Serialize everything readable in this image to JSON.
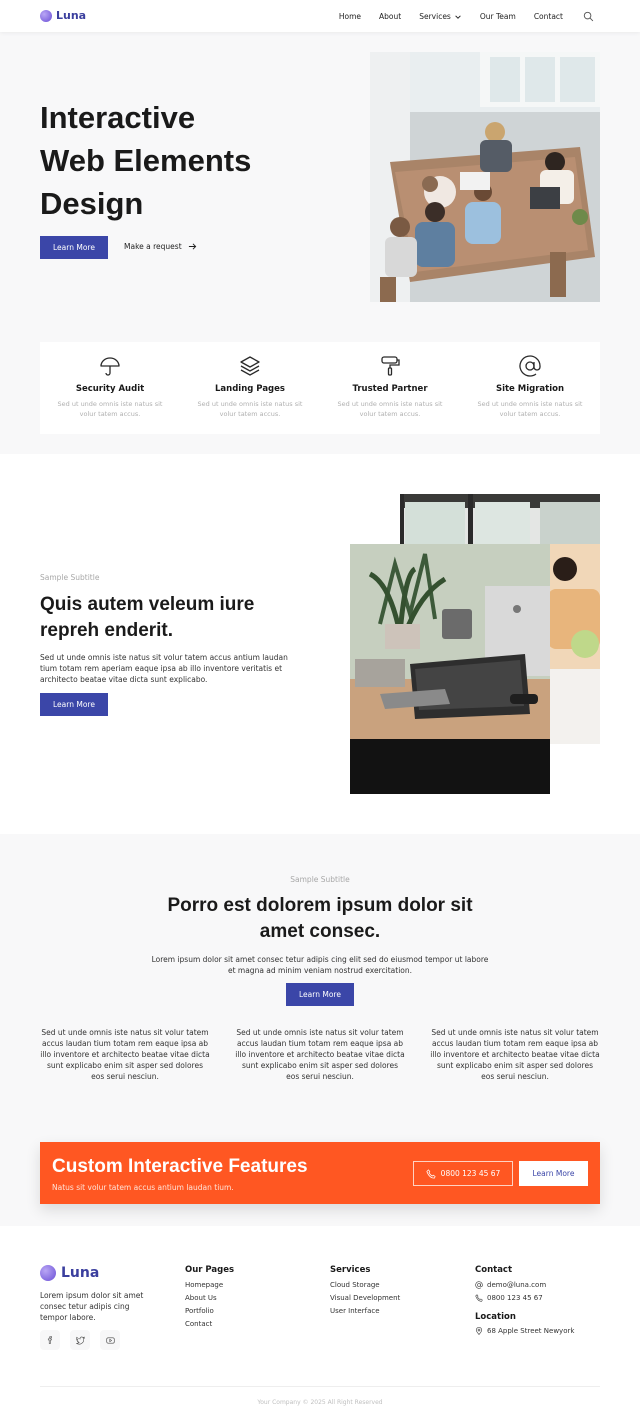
{
  "brand": {
    "name": "Luna",
    "accent": "#3b46a8",
    "cta_color": "#ff5722"
  },
  "nav": {
    "items": [
      "Home",
      "About",
      "Services",
      "Our Team",
      "Contact"
    ],
    "search_icon": "search-icon"
  },
  "hero": {
    "title_line1": "Interactive",
    "title_line2": "Web Elements",
    "title_line3": "Design",
    "primary_button": "Learn More",
    "secondary_link": "Make a request"
  },
  "features": [
    {
      "icon": "umbrella-icon",
      "title": "Security Audit",
      "text": "Sed ut unde omnis iste natus sit volur tatem accus."
    },
    {
      "icon": "layers-icon",
      "title": "Landing Pages",
      "text": "Sed ut unde omnis iste natus sit volur tatem accus."
    },
    {
      "icon": "paint-roller-icon",
      "title": "Trusted Partner",
      "text": "Sed ut unde omnis iste natus sit volur tatem accus."
    },
    {
      "icon": "at-sign-icon",
      "title": "Site Migration",
      "text": "Sed ut unde omnis iste natus sit volur tatem accus."
    }
  ],
  "section2": {
    "subtitle": "Sample Subtitle",
    "title_line1": "Quis autem veleum iure",
    "title_line2": "repreh enderit.",
    "body_line1": "Sed ut unde omnis iste natus sit volur tatem accus antium laudan",
    "body_line2": "tium totam rem aperiam eaque ipsa ab illo inventore veritatis et",
    "body_line3": "architecto beatae vitae dicta sunt explicabo.",
    "button": "Learn More"
  },
  "section3": {
    "subtitle": "Sample Subtitle",
    "title_line1": "Porro est dolorem ipsum dolor sit",
    "title_line2": "amet consec.",
    "body_line1": "Lorem ipsum dolor sit amet consec tetur adipis cing elit sed do eiusmod tempor ut labore",
    "body_line2": "et magna ad minim veniam nostrud exercitation.",
    "button": "Learn More",
    "columns": [
      "Sed ut unde omnis iste natus sit volur tatem accus laudan tium totam rem eaque ipsa ab illo inventore et architecto beatae vitae dicta sunt explicabo enim sit asper sed dolores eos serui nesciun.",
      "Sed ut unde omnis iste natus sit volur tatem accus laudan tium totam rem eaque ipsa ab illo inventore et architecto beatae vitae dicta sunt explicabo enim sit asper sed dolores eos serui nesciun.",
      "Sed ut unde omnis iste natus sit volur tatem accus laudan tium totam rem eaque ipsa ab illo inventore et architecto beatae vitae dicta sunt explicabo enim sit asper sed dolores eos serui nesciun."
    ]
  },
  "cta": {
    "title": "Custom Interactive Features",
    "subtitle": "Natus sit volur tatem accus antium laudan tium.",
    "phone": "0800 123 45 67",
    "button": "Learn More"
  },
  "footer": {
    "about_line1": "Lorem ipsum dolor sit amet",
    "about_line2": "consec tetur adipis cing",
    "about_line3": "tempor labore.",
    "pages_title": "Our Pages",
    "pages": [
      "Homepage",
      "About Us",
      "Portfolio",
      "Contact"
    ],
    "services_title": "Services",
    "services": [
      "Cloud Storage",
      "Visual Development",
      "User Interface"
    ],
    "contact_title": "Contact",
    "email": "demo@luna.com",
    "phone": "0800 123 45 67",
    "location_title": "Location",
    "address": "68 Apple Street Newyork",
    "copyright": "Your Company © 2025 All Right Reserved"
  }
}
